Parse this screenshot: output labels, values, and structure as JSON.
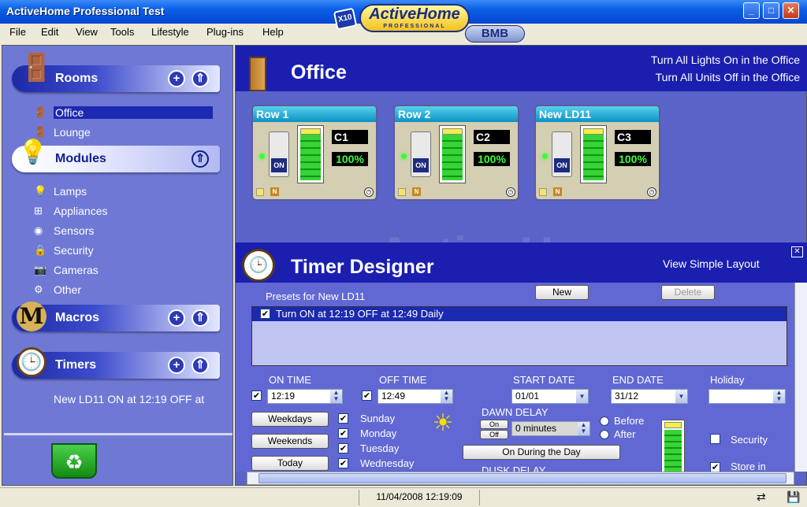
{
  "window": {
    "title": "ActiveHome Professional Test"
  },
  "logo": {
    "x10": "X10",
    "brand": "ActiveHome",
    "sub": "PROFESSIONAL",
    "partner": "BMB"
  },
  "menu": [
    "File",
    "Edit",
    "View",
    "Tools",
    "Lifestyle",
    "Plug-ins",
    "Help"
  ],
  "sidebar": {
    "rooms_label": "Rooms",
    "rooms": [
      "Office",
      "Lounge"
    ],
    "modules_label": "Modules",
    "modules": [
      "Lamps",
      "Appliances",
      "Sensors",
      "Security",
      "Cameras",
      "Other"
    ],
    "macros_label": "Macros",
    "timers_label": "Timers",
    "timers": [
      "New LD11 ON at 12:19 OFF at"
    ]
  },
  "room": {
    "title": "Office",
    "link_lights": "Turn All Lights On in the Office",
    "link_units": "Turn All Units Off in the Office",
    "watermark": "ActiveHome"
  },
  "modules": [
    {
      "title": "Row 1",
      "address": "C1",
      "level": "100%",
      "level_frac": 1.0,
      "state": "ON"
    },
    {
      "title": "Row 2",
      "address": "C2",
      "level": "100%",
      "level_frac": 1.0,
      "state": "ON"
    },
    {
      "title": "New LD11",
      "address": "C3",
      "level": "100%",
      "level_frac": 1.0,
      "state": "ON"
    }
  ],
  "timer": {
    "title": "Timer Designer",
    "simple_layout": "View Simple Layout",
    "presets_label": "Presets for New LD11",
    "new_button": "New",
    "delete_button": "Delete",
    "preset_row": "Turn ON at 12:19 OFF at 12:49 Daily",
    "on_time_label": "ON TIME",
    "on_time": "12:19",
    "off_time_label": "OFF TIME",
    "off_time": "12:49",
    "start_date_label": "START DATE",
    "start_date": "01/01",
    "end_date_label": "END DATE",
    "end_date": "31/12",
    "holiday_label": "Holiday",
    "holiday": "",
    "weekdays": "Weekdays",
    "weekends": "Weekends",
    "today": "Today",
    "days": [
      "Sunday",
      "Monday",
      "Tuesday",
      "Wednesday"
    ],
    "dawn_delay_label": "DAWN DELAY",
    "dawn_on": "On",
    "dawn_off": "Off",
    "dawn_minutes": "0 minutes",
    "before": "Before",
    "after": "After",
    "on_during_day": "On During the Day",
    "dusk_delay_label": "DUSK DELAY",
    "security": "Security",
    "store_in": "Store in"
  },
  "status": {
    "datetime": "11/04/2008 12:19:09"
  }
}
